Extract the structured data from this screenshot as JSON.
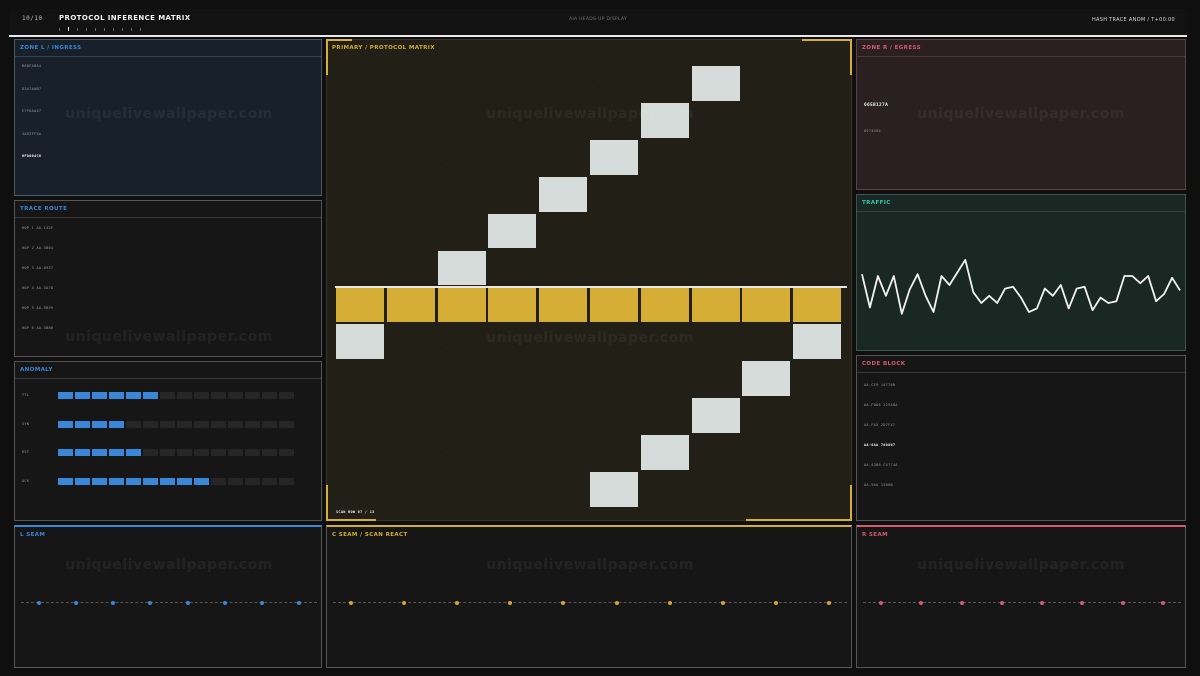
{
  "header": {
    "page": "10/10",
    "title": "PROTOCOL INFERENCE MATRIX",
    "subtitle": "AIA HEADS-UP DISPLAY",
    "right": "HASH TRACE ANOM  /  T+00:00"
  },
  "watermark": "uniquelivewallpaper.com",
  "zone_l": {
    "title": "ZONE L  /  INGRESS",
    "items": [
      "B60FABA4",
      "D3A7A0B7",
      "E7F6AA47",
      "4A83FF5A",
      "6F8004C8"
    ],
    "highlight_index": 4
  },
  "trace_route": {
    "title": "TRACE ROUTE",
    "items": [
      "HOP 1  AA-142F",
      "HOP 2  AA-3B04",
      "HOP 3  AA-0937",
      "HOP 4  AA-3A78",
      "HOP 5  AA-9B49",
      "HOP 6  AA-3B80"
    ]
  },
  "anomaly": {
    "title": "ANOMALY",
    "rows": [
      {
        "label": "TTL",
        "level": 0.42
      },
      {
        "label": "SYN",
        "level": 0.28
      },
      {
        "label": "RST",
        "level": 0.35
      },
      {
        "label": "ACK",
        "level": 0.64
      }
    ]
  },
  "primary": {
    "title": "PRIMARY  /  PROTOCOL MATRIX",
    "scan_row": "SCAN ROW 07 / 13",
    "grid": {
      "cols": 10,
      "rows": 13,
      "highlight_row": 6
    },
    "path_cells": [
      [
        7,
        0
      ],
      [
        6,
        1
      ],
      [
        5,
        2
      ],
      [
        4,
        3
      ],
      [
        3,
        4
      ],
      [
        2,
        5
      ],
      [
        0,
        7
      ],
      [
        9,
        7
      ],
      [
        8,
        8
      ],
      [
        7,
        9
      ],
      [
        6,
        10
      ],
      [
        5,
        11
      ]
    ]
  },
  "zone_r": {
    "title": "ZONE R  /  EGRESS",
    "value": "665B127A",
    "sub": "0974494"
  },
  "traffic": {
    "title": "TRAFFIC",
    "values": [
      0.62,
      0.25,
      0.6,
      0.38,
      0.6,
      0.18,
      0.45,
      0.62,
      0.38,
      0.2,
      0.6,
      0.5,
      0.64,
      0.78,
      0.42,
      0.3,
      0.38,
      0.3,
      0.46,
      0.48,
      0.36,
      0.2,
      0.24,
      0.46,
      0.38,
      0.5,
      0.24,
      0.46,
      0.48,
      0.22,
      0.36,
      0.3,
      0.32,
      0.6,
      0.6,
      0.52,
      0.6,
      0.32,
      0.4,
      0.58,
      0.44
    ]
  },
  "code_block": {
    "title": "CODE BLOCK",
    "items": [
      "AA-CE9 14776B",
      "AA-F086  229A8A",
      "AA-FA5  2D7F47",
      "AA-0AA 780807",
      "AA-43B8  C4774A",
      "AA-9AA  1380B"
    ],
    "highlight_index": 3
  },
  "l_seam": {
    "title": "L SEAM",
    "dots": 8,
    "color": "#3a86d8"
  },
  "c_seam": {
    "title": "C SEAM  /  SCAN REACT",
    "dots": 10,
    "color": "#d6a72c"
  },
  "r_seam": {
    "title": "R SEAM",
    "dots": 8,
    "color": "#d65a6e"
  },
  "colors": {
    "blue": "#3a86d8",
    "gold": "#d6ae35",
    "red": "#d65a6e",
    "teal": "#2ecfa8",
    "path_cell": "#d6dcd9"
  }
}
